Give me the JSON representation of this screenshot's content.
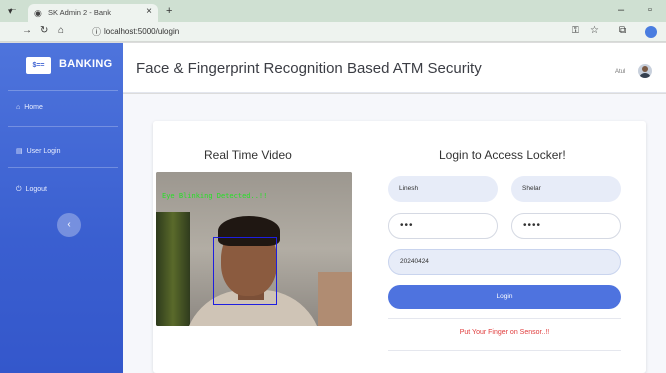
{
  "browser": {
    "tab_title": "SK Admin 2 - Bank",
    "tab_close": "×",
    "new_tab": "+",
    "menu_chevron": "▾",
    "minimize": "–",
    "maximize": "▫",
    "url": "localhost:5000/ulogin",
    "icons": [
      "back-icon",
      "forward-icon",
      "reload-icon",
      "home-icon",
      "site-info-icon",
      "password-key-icon",
      "star-icon",
      "extensions-icon",
      "profile-icon"
    ]
  },
  "sidebar": {
    "brand_logo": "$==",
    "brand_name": "BANKING",
    "items": [
      {
        "label": "Home",
        "icon": "⌂"
      },
      {
        "label": "User Login",
        "icon": "▤"
      },
      {
        "label": "Logout",
        "icon": "⏻"
      }
    ],
    "toggle_icon": "‹"
  },
  "header": {
    "title": "Face & Fingerprint Recognition Based ATM Security",
    "user_name": "Atul"
  },
  "video_panel": {
    "heading": "Real Time Video",
    "overlay_text": "Eye Blinking Detected..!!"
  },
  "login_panel": {
    "heading": "Login to Access Locker!",
    "first_name": "Linesh",
    "last_name": "Shelar",
    "pin1": "•••",
    "pin2": "••••",
    "account_no": "20240424",
    "login_label": "Login",
    "message": "Put Your Finger on Sensor..!!"
  },
  "colors": {
    "sidebar": "#4e74dc",
    "accent": "#4e73df",
    "message": "#e03c3c",
    "overlay": "#27e027",
    "facebox": "#1e1ee0"
  }
}
